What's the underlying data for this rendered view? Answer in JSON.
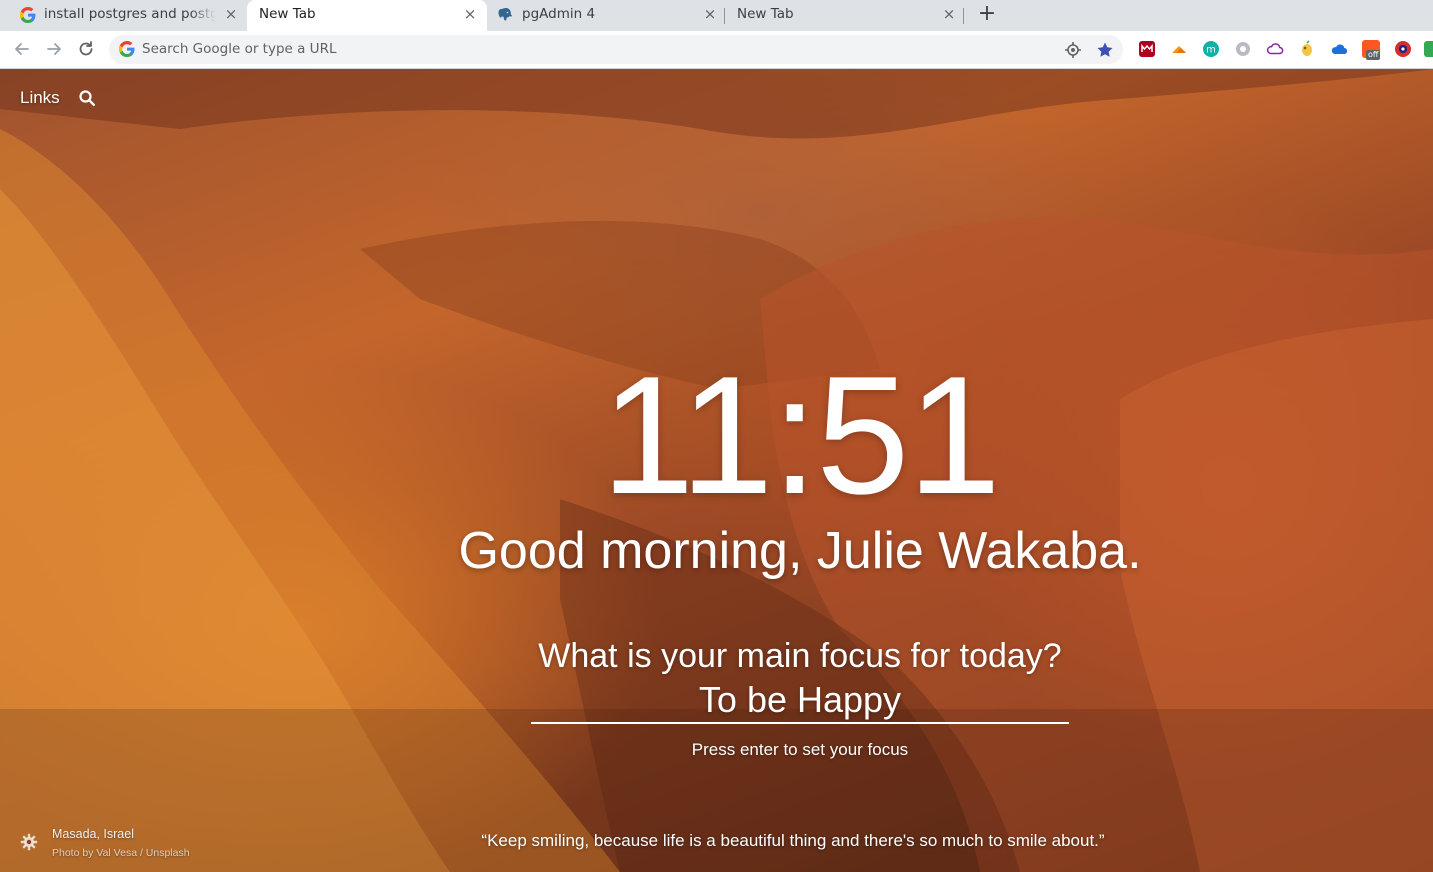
{
  "browser": {
    "tabs": [
      {
        "title": "install postgres and postg",
        "favicon": "google-g-icon",
        "active": false
      },
      {
        "title": "New Tab",
        "favicon": "",
        "active": true
      },
      {
        "title": "pgAdmin 4",
        "favicon": "pgadmin-elephant-icon",
        "active": false
      },
      {
        "title": "New Tab",
        "favicon": "",
        "active": false
      }
    ],
    "close_glyph": "×",
    "new_tab_glyph": "+",
    "omnibox": {
      "placeholder": "Search Google or type a URL"
    },
    "extensions": [
      "mega-icon",
      "orange-ext-icon",
      "teal-m-icon",
      "gear-ext-icon",
      "cloud-purple-icon",
      "lemon-icon",
      "cloud-blue-icon",
      "off-badge-icon",
      "red-circle-icon",
      "green-ext-icon"
    ],
    "extension_badge": "off"
  },
  "momentum": {
    "links_label": "Links",
    "time": "11:51",
    "greeting": "Good morning, Julie Wakaba.",
    "focus_question": "What is your main focus for today?",
    "focus_value": "To be Happy",
    "focus_hint": "Press enter to set your focus",
    "location": "Masada, Israel",
    "photo_credit": "Photo by Val Vesa / Unsplash",
    "quote": "“Keep smiling, because life is a beautiful thing and there's so much to smile about.”"
  }
}
